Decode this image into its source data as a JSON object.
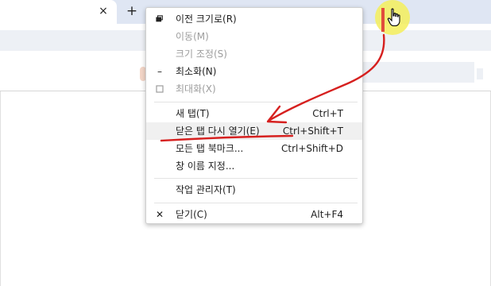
{
  "tab": {
    "close_symbol": "×",
    "new_tab_symbol": "+"
  },
  "menu": {
    "items": [
      {
        "label": "이전 크기로(R)",
        "shortcut": "",
        "enabled": true,
        "icon": "restore-icon"
      },
      {
        "label": "이동(M)",
        "shortcut": "",
        "enabled": false
      },
      {
        "label": "크기 조정(S)",
        "shortcut": "",
        "enabled": false
      },
      {
        "label": "최소화(N)",
        "shortcut": "",
        "enabled": true,
        "icon": "minimize-icon"
      },
      {
        "label": "최대화(X)",
        "shortcut": "",
        "enabled": false,
        "icon": "maximize-icon"
      },
      {
        "label": "새 탭(T)",
        "shortcut": "Ctrl+T",
        "enabled": true
      },
      {
        "label": "닫은 탭 다시 열기(E)",
        "shortcut": "Ctrl+Shift+T",
        "enabled": true,
        "highlighted": true
      },
      {
        "label": "모든 탭 북마크...",
        "shortcut": "Ctrl+Shift+D",
        "enabled": true
      },
      {
        "label": "창 이름 지정...",
        "shortcut": "",
        "enabled": true
      },
      {
        "label": "작업 관리자(T)",
        "shortcut": "",
        "enabled": true
      },
      {
        "label": "닫기(C)",
        "shortcut": "Alt+F4",
        "enabled": true,
        "icon": "close-icon"
      }
    ],
    "icons": {
      "minimize": "–",
      "close": "✕"
    }
  },
  "colors": {
    "annotation_red": "#d6201f",
    "cursor_highlight": "#f4ef5a",
    "tabstrip": "#dfe6f3"
  }
}
